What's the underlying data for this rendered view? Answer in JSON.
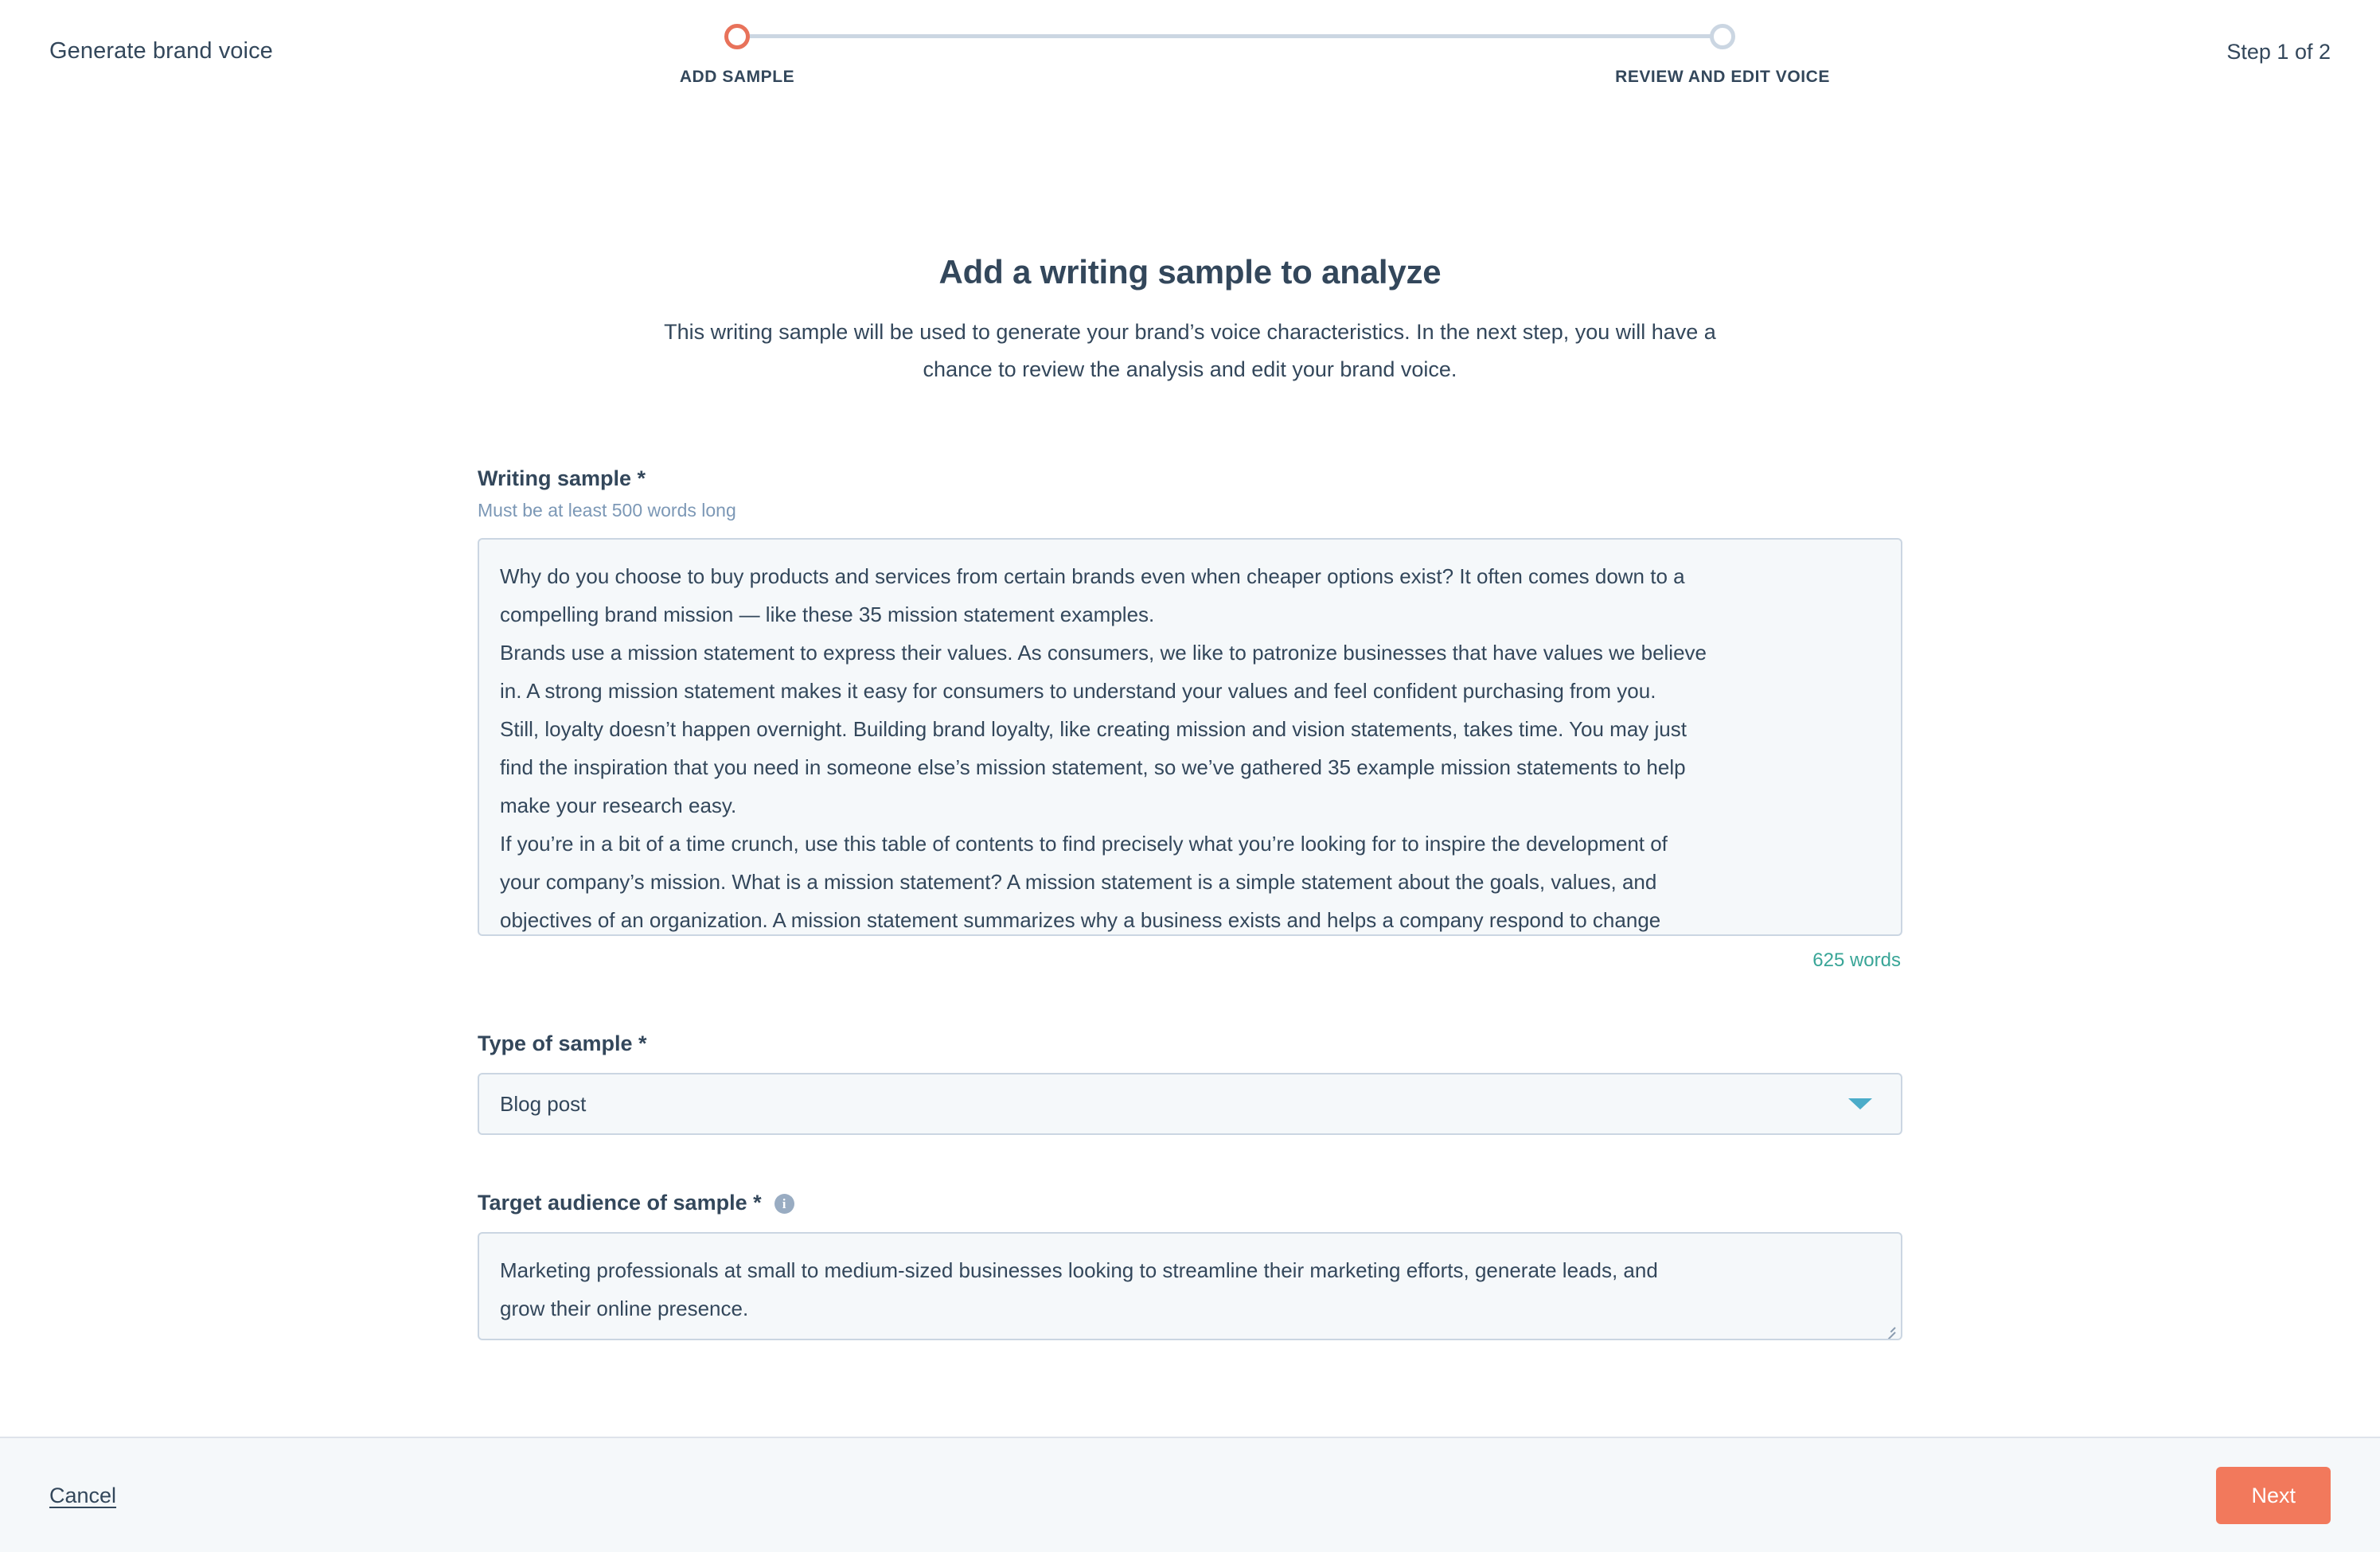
{
  "header": {
    "title": "Generate brand voice",
    "step_counter": "Step 1 of 2",
    "steps": [
      {
        "label": "ADD SAMPLE",
        "state": "active",
        "color": "#e8725a"
      },
      {
        "label": "REVIEW AND EDIT VOICE",
        "state": "inactive",
        "color": "#cbd6e2"
      }
    ]
  },
  "main": {
    "title": "Add a writing sample to analyze",
    "subtitle": "This writing sample will be used to generate your brand’s voice characteristics. In the next step, you will have a chance to review the analysis and edit your brand voice."
  },
  "writing_sample": {
    "label": "Writing sample *",
    "help": "Must be at least 500 words long",
    "lines": [
      "Why do you choose to buy products and services from certain brands even when cheaper options exist? It often comes down to a",
      "compelling brand mission — like these 35 mission statement examples.",
      "Brands use a mission statement to express their values. As consumers, we like to patronize businesses that have values we believe",
      "in. A strong mission statement makes it easy for consumers to understand your values and feel confident purchasing from you.",
      "Still, loyalty doesn’t happen overnight. Building brand loyalty, like creating mission and vision statements, takes time. You may just",
      "find the inspiration that you need in someone else’s mission statement, so we’ve gathered 35 example mission statements to help",
      "make your research easy.",
      "If you’re in a bit of a time crunch, use this table of contents to find precisely what you’re looking for to inspire the development of",
      "your company’s mission. What is a mission statement? A mission statement is a simple statement about the goals, values, and",
      "objectives of an organization. A mission statement summarizes why a business exists and helps a company respond to change"
    ],
    "word_count": "625 words",
    "word_count_color": "#39a597"
  },
  "type_of_sample": {
    "label": "Type of sample *",
    "value": "Blog post",
    "caret_color": "#4bacc9"
  },
  "target_audience": {
    "label": "Target audience of sample *",
    "info_glyph": "i",
    "lines": [
      "Marketing professionals at small to medium-sized businesses looking to streamline their marketing efforts, generate leads, and",
      "grow their online presence."
    ]
  },
  "footer": {
    "cancel_label": "Cancel",
    "next_label": "Next",
    "next_color": "#f2795c"
  }
}
